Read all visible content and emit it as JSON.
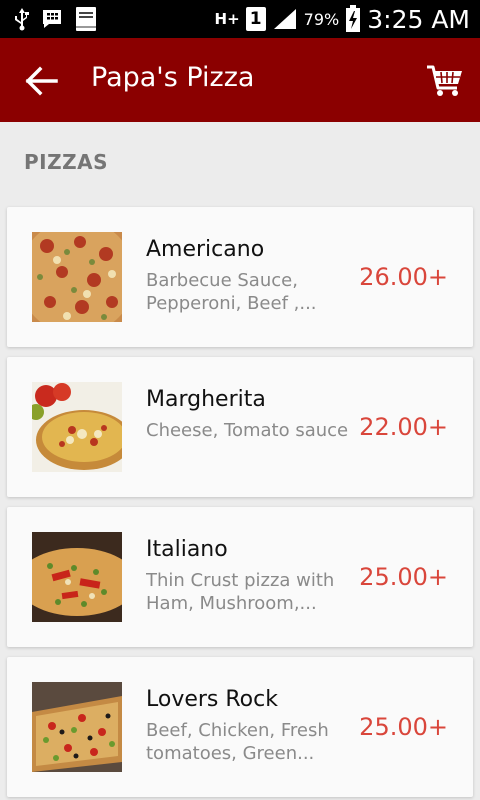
{
  "status_bar": {
    "network_label": "H+",
    "sim_label": "1",
    "battery_percent": "79%",
    "time": "3:25 AM",
    "icons": [
      "usb-icon",
      "bbm-icon",
      "bible-app-icon",
      "network-hplus-icon",
      "sim-icon",
      "signal-icon",
      "battery-charging-icon"
    ]
  },
  "app_bar": {
    "title": "Papa's Pizza",
    "color": "#8b0000",
    "back_icon": "arrow-left-icon",
    "cart_icon": "shopping-cart-icon"
  },
  "section": {
    "title": "PIZZAS"
  },
  "accent_price_color": "#d9463b",
  "items": [
    {
      "name": "Americano",
      "description": "Barbecue Sauce, Pepperoni, Beef ,...",
      "price": "26.00+"
    },
    {
      "name": "Margherita",
      "description": "Cheese, Tomato sauce",
      "price": "22.00+"
    },
    {
      "name": "Italiano",
      "description": "Thin Crust pizza with Ham, Mushroom,...",
      "price": "25.00+"
    },
    {
      "name": "Lovers Rock",
      "description": "Beef, Chicken, Fresh tomatoes, Green...",
      "price": "25.00+"
    }
  ]
}
